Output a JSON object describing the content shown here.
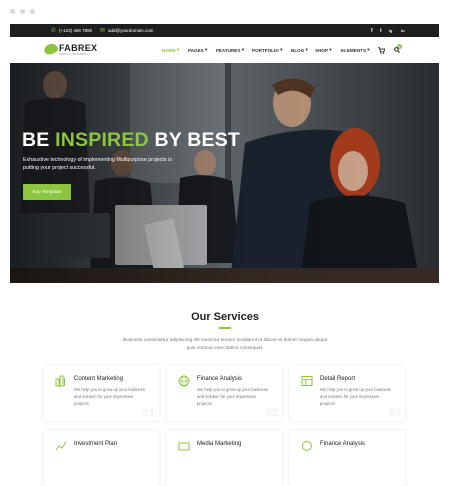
{
  "colors": {
    "accent": "#8cc63f",
    "topbar": "#1e1e1e",
    "text": "#222222"
  },
  "topbar": {
    "phone_icon": "phone-icon",
    "phone": "(+123) 456 7890",
    "email_icon": "envelope-icon",
    "email": "add@yourdomain.com",
    "social": [
      "f",
      "t",
      "ig",
      "in"
    ]
  },
  "brand": {
    "name": "FABREX",
    "tagline": "FOR ALL BUSINESS"
  },
  "nav": {
    "items": [
      {
        "label": "HOME",
        "active": true
      },
      {
        "label": "PAGES",
        "active": false
      },
      {
        "label": "FEATURES",
        "active": false
      },
      {
        "label": "PORTFOLIO",
        "active": false
      },
      {
        "label": "BLOG",
        "active": false
      },
      {
        "label": "SHOP",
        "active": false
      },
      {
        "label": "ELEMENTS",
        "active": false
      }
    ],
    "cart_count": "0",
    "cart_icon": "cart-icon",
    "search_icon": "search-icon"
  },
  "hero": {
    "title_part1": "BE",
    "title_part2": "INSPIRED",
    "title_part3": "BY BEST",
    "description": "Exhaustive technology of implementing Multipurpose projects is putting your project successful.",
    "button": "Buy Template"
  },
  "services": {
    "title": "Our Services",
    "description": "Business consectetur adipisicing elit eiusmod tempor incididunt ut labore et dolore magna aliqua quis nostrud exercitation consequat.",
    "cards": [
      {
        "title": "Content Marketing",
        "text": "We help you to grow up your business and solution for your impressive projects.",
        "num": "01",
        "icon": "content-marketing-icon"
      },
      {
        "title": "Finance Analysis",
        "text": "We help you to grow up your business and solution for your impressive projects.",
        "num": "02",
        "icon": "globe-icon"
      },
      {
        "title": "Detail Report",
        "text": "We help you to grow up your business and solution for your impressive projects.",
        "num": "03",
        "icon": "report-icon"
      },
      {
        "title": "Investment Plan",
        "icon": "investment-icon"
      },
      {
        "title": "Media Marketing",
        "icon": "media-icon"
      },
      {
        "title": "Finance Analysis",
        "icon": "finance-icon"
      }
    ]
  }
}
